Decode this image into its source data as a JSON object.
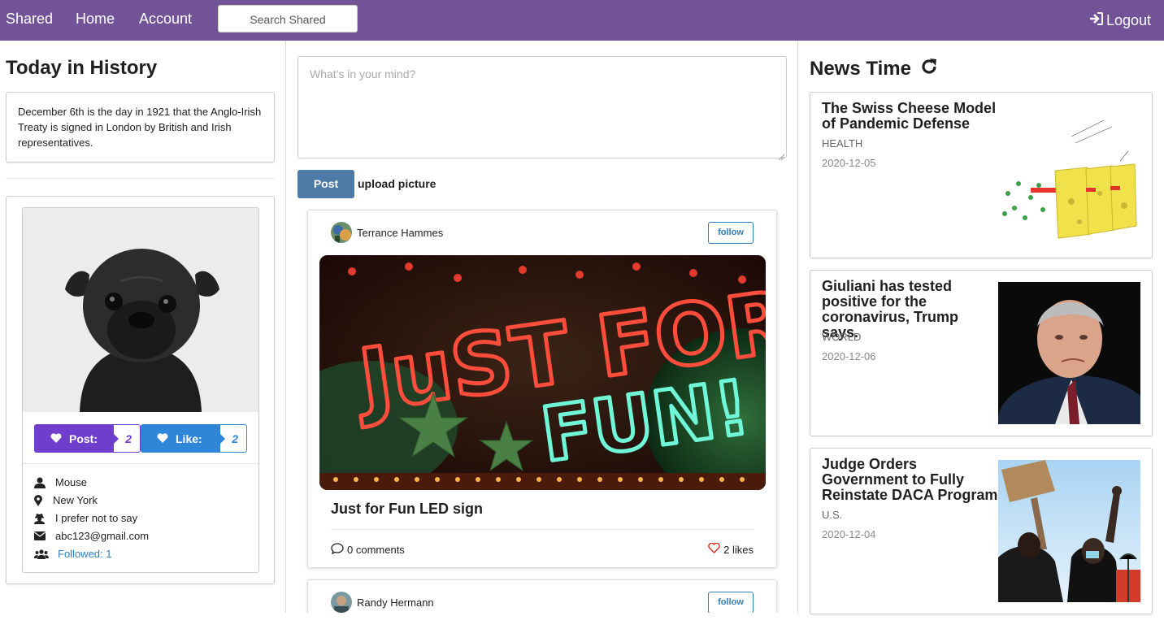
{
  "nav": {
    "brand": "Shared",
    "home": "Home",
    "account": "Account",
    "search_placeholder": "Search Shared",
    "logout": "Logout"
  },
  "history": {
    "title": "Today in History",
    "text": "December 6th is the day in 1921 that the Anglo-Irish Treaty is signed in London by British and Irish representatives."
  },
  "profile": {
    "post_label": "Post:",
    "post_count": "2",
    "like_label": "Like:",
    "like_count": "2",
    "name": "Mouse",
    "location": "New York",
    "gender": "I prefer not to say",
    "email": "abc123@gmail.com",
    "followed": "Followed: 1"
  },
  "composer": {
    "placeholder": "What's in your mind?",
    "post_button": "Post",
    "upload": "upload picture"
  },
  "feed": [
    {
      "author": "Terrance Hammes",
      "follow": "follow",
      "title": "Just for Fun LED sign",
      "comments": "0 comments",
      "likes": "2 likes"
    },
    {
      "author": "Randy Hermann",
      "follow": "follow"
    }
  ],
  "news": {
    "title": "News Time",
    "items": [
      {
        "title": "The Swiss Cheese Model of Pandemic Defense",
        "category": "HEALTH",
        "date": "2020-12-05"
      },
      {
        "title": "Giuliani has tested positive for the coronavirus, Trump says.",
        "category": "WORLD",
        "date": "2020-12-06"
      },
      {
        "title": "Judge Orders Government to Fully Reinstate DACA Program",
        "category": "U.S.",
        "date": "2020-12-04"
      }
    ]
  },
  "colors": {
    "nav": "#725397",
    "post_label": "#6f3ecc",
    "like_label": "#2f86d8",
    "post_button": "#4e7aa7",
    "link": "#2f7fc1"
  }
}
